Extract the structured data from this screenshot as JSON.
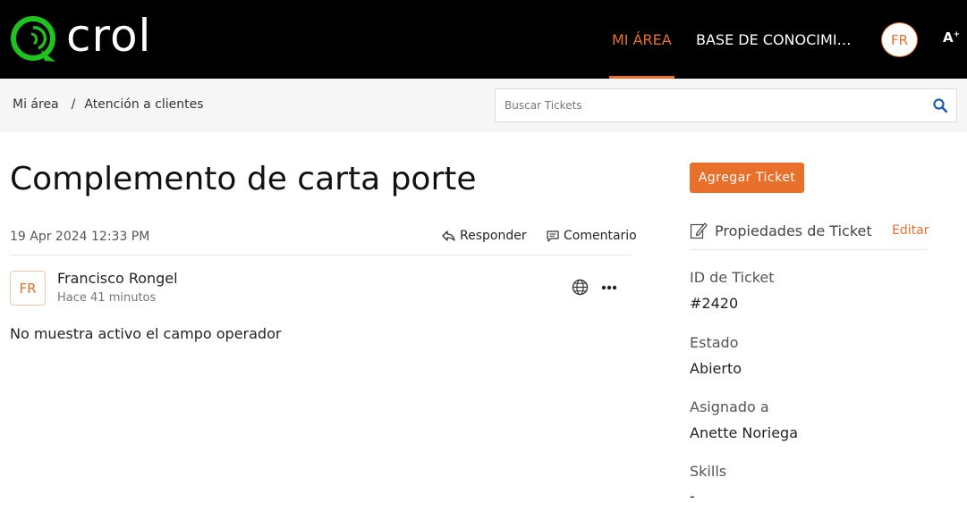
{
  "header": {
    "brand": "crol",
    "nav": [
      {
        "label": "MI ÁREA",
        "active": true
      },
      {
        "label": "BASE DE CONOCIMI…",
        "active": false
      }
    ],
    "user_initials": "FR",
    "font_size_label": "A",
    "font_size_sup": "+"
  },
  "breadcrumb": {
    "items": [
      "Mi área",
      "Atención a clientes"
    ],
    "separator": "/"
  },
  "search": {
    "placeholder": "Buscar Tickets",
    "value": ""
  },
  "ticket": {
    "title": "Complemento de carta porte",
    "date": "19 Apr 2024 12:33 PM",
    "actions": {
      "reply": "Responder",
      "comment": "Comentario"
    },
    "post": {
      "initials": "FR",
      "author": "Francisco Rongel",
      "time": "Hace 41 minutos",
      "message": "No muestra activo el campo operador"
    }
  },
  "sidebar": {
    "add_ticket": "Agregar Ticket",
    "properties_title": "Propiedades de Ticket",
    "edit": "Editar",
    "properties": [
      {
        "label": "ID de Ticket",
        "value": "#2420"
      },
      {
        "label": "Estado",
        "value": "Abierto"
      },
      {
        "label": "Asignado a",
        "value": "Anette Noriega"
      },
      {
        "label": "Skills",
        "value": "-"
      }
    ]
  },
  "colors": {
    "accent": "#e8702a",
    "brand_green": "#1ec31e",
    "header_bg": "#000000"
  }
}
